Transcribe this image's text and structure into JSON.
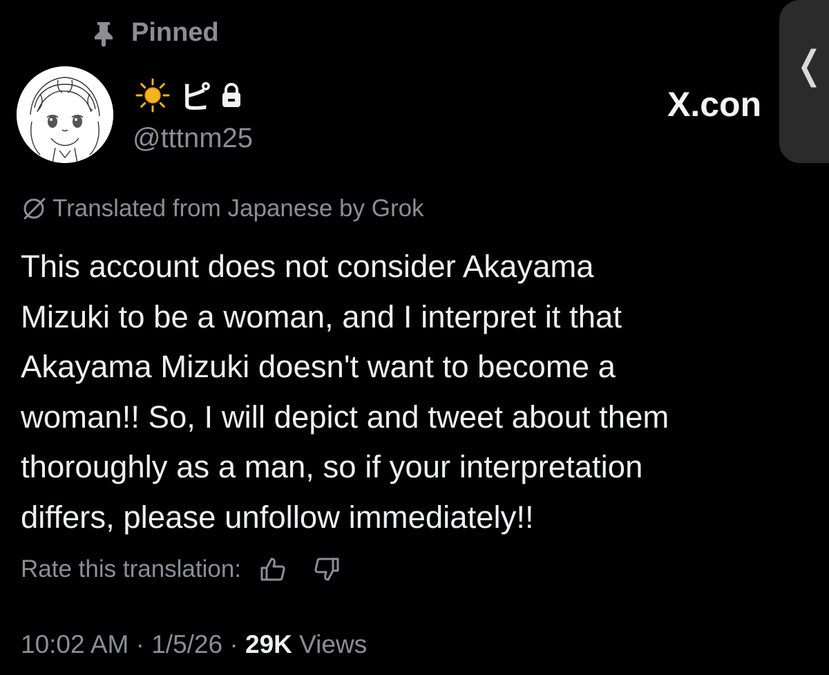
{
  "pinned": {
    "label": "Pinned",
    "icon": "pin-icon"
  },
  "author": {
    "display_name": "ピ",
    "handle": "@tttnm25",
    "protected": true,
    "name_emoji": "sun-icon"
  },
  "source_label": "X.con",
  "translation": {
    "label": "Translated from Japanese by Grok",
    "icon": "grok-icon"
  },
  "tweet": {
    "text": "This account does not consider Akayama\nMizuki to be a woman, and I interpret it that\nAkayama Mizuki doesn't want to become a\nwoman!! So, I will depict and tweet about them\nthoroughly as a man, so if your interpretation\ndiffers, please unfollow immediately!!"
  },
  "rate": {
    "label": "Rate this translation:"
  },
  "meta": {
    "time": "10:02 AM",
    "separator": " · ",
    "date": "1/5/26",
    "views_count": "29K",
    "views_label": "Views"
  },
  "colors": {
    "background": "#000000",
    "text": "#e7e9ea",
    "secondary": "#8b8f94",
    "sun": "#f5b31c"
  }
}
